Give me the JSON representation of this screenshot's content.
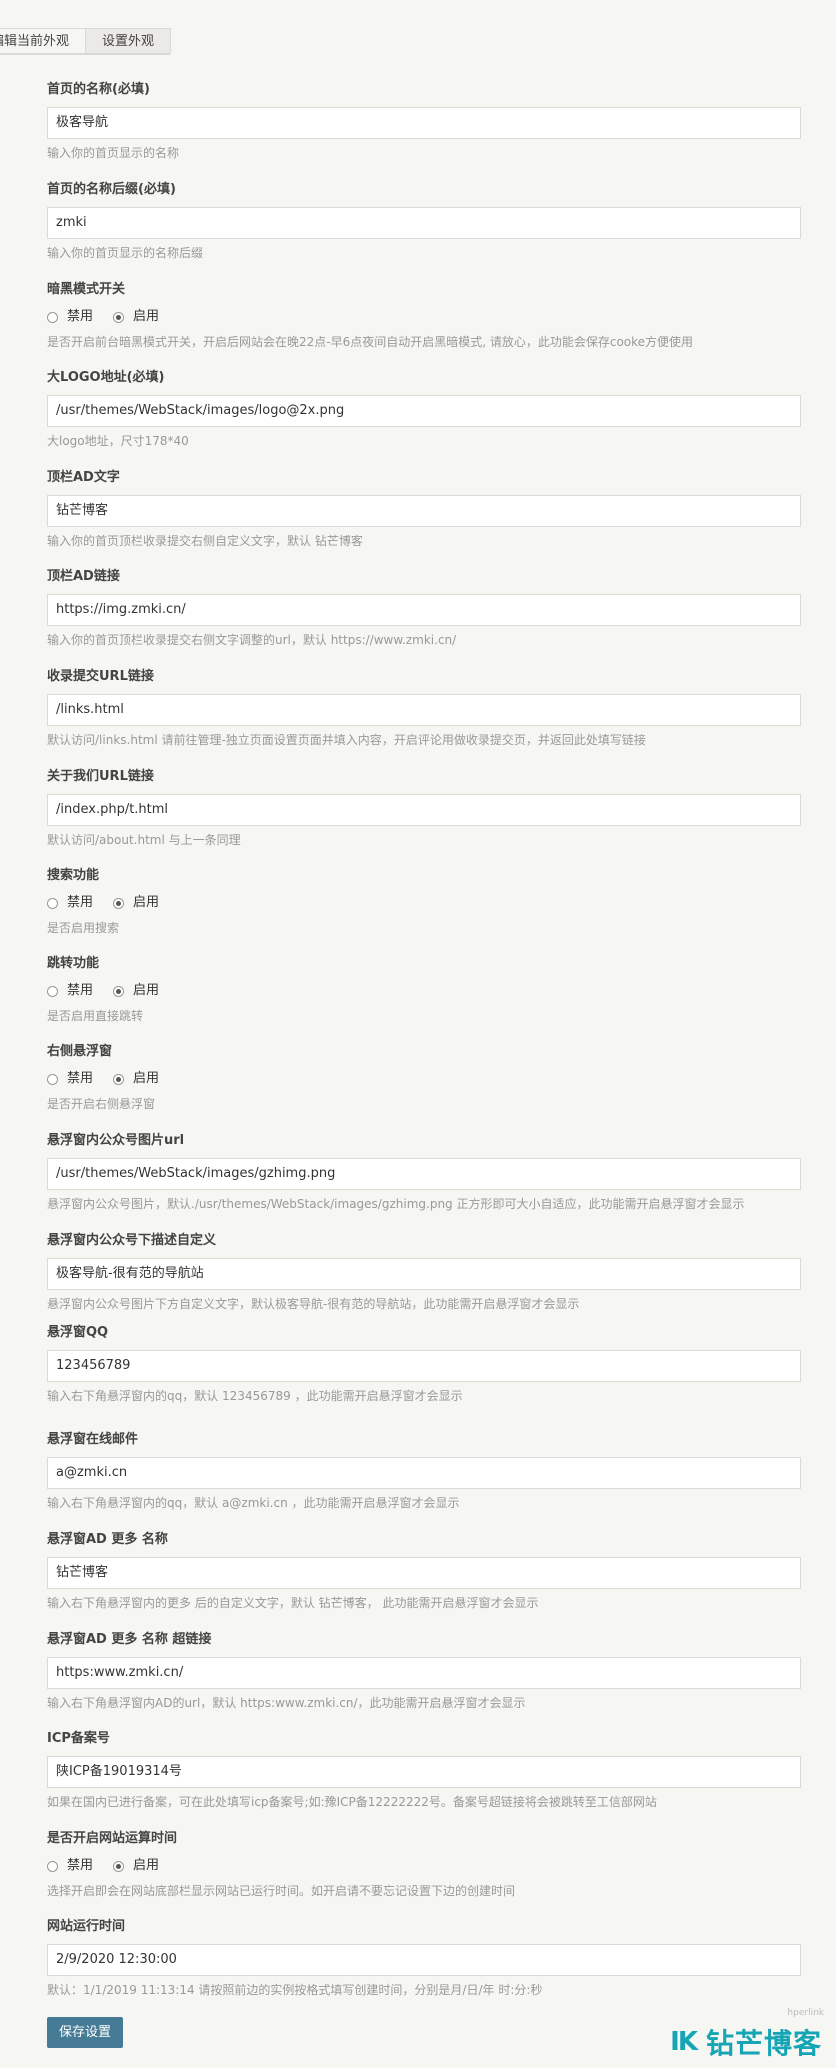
{
  "tabs": [
    {
      "label": "编辑当前外观"
    },
    {
      "label": "设置外观"
    }
  ],
  "fields": [
    {
      "label": "首页的名称(必填)",
      "value": "极客导航",
      "desc": "输入你的首页显示的名称"
    },
    {
      "label": "首页的名称后缀(必填)",
      "value": "zmki",
      "desc": "输入你的首页显示的名称后缀"
    },
    {
      "label": "暗黑模式开关",
      "radio": [
        "禁用",
        "启用"
      ],
      "desc": "是否开启前台暗黑模式开关，开启后网站会在晚22点-早6点夜间自动开启黑暗模式, 请放心，此功能会保存cooke方便使用"
    },
    {
      "label": "大LOGO地址(必填)",
      "value": "/usr/themes/WebStack/images/logo@2x.png",
      "desc": "大logo地址，尺寸178*40"
    },
    {
      "label": "顶栏AD文字",
      "value": "钻芒博客",
      "desc": "输入你的首页顶栏收录提交右侧自定义文字，默认 钻芒博客"
    },
    {
      "label": "顶栏AD链接",
      "value": "https://img.zmki.cn/",
      "desc": "输入你的首页顶栏收录提交右侧文字调整的url，默认 https://www.zmki.cn/"
    },
    {
      "label": "收录提交URL链接",
      "value": "/links.html",
      "desc": "默认访问/links.html 请前往管理-独立页面设置页面并填入内容，开启评论用做收录提交页，并返回此处填写链接"
    },
    {
      "label": "关于我们URL链接",
      "value": "/index.php/t.html",
      "desc": "默认访问/about.html 与上一条同理"
    },
    {
      "label": "搜索功能",
      "radio": [
        "禁用",
        "启用"
      ],
      "desc": "是否启用搜索"
    },
    {
      "label": "跳转功能",
      "radio": [
        "禁用",
        "启用"
      ],
      "desc": "是否启用直接跳转"
    },
    {
      "label": "右侧悬浮窗",
      "radio": [
        "禁用",
        "启用"
      ],
      "desc": "是否开启右侧悬浮窗"
    },
    {
      "label": "悬浮窗内公众号图片url",
      "value": "/usr/themes/WebStack/images/gzhimg.png",
      "desc": "悬浮窗内公众号图片，默认./usr/themes/WebStack/images/gzhimg.png 正方形即可大小自适应，此功能需开启悬浮窗才会显示"
    },
    {
      "label": "悬浮窗内公众号下描述自定义",
      "value": "极客导航-很有范的导航站",
      "desc": "悬浮窗内公众号图片下方自定义文字，默认极客导航-很有范的导航站，此功能需开启悬浮窗才会显示"
    },
    {
      "label": "悬浮窗QQ",
      "value": "123456789",
      "desc": "输入右下角悬浮窗内的qq，默认 123456789 ，此功能需开启悬浮窗才会显示"
    },
    {
      "label": "悬浮窗在线邮件",
      "value": "a@zmki.cn",
      "desc": "输入右下角悬浮窗内的qq，默认 a@zmki.cn ，此功能需开启悬浮窗才会显示"
    },
    {
      "label": "悬浮窗AD 更多 名称",
      "value": "钻芒博客",
      "desc": "输入右下角悬浮窗内的更多 后的自定义文字，默认 钻芒博客， 此功能需开启悬浮窗才会显示"
    },
    {
      "label": "悬浮窗AD 更多 名称 超链接",
      "value": "https:www.zmki.cn/",
      "desc": "输入右下角悬浮窗内AD的url，默认 https:www.zmki.cn/，此功能需开启悬浮窗才会显示"
    },
    {
      "label": "ICP备案号",
      "value": "陕ICP备19019314号",
      "desc": "如果在国内已进行备案，可在此处填写icp备案号;如:豫ICP备12222222号。备案号超链接将会被跳转至工信部网站"
    },
    {
      "label": "是否开启网站运算时间",
      "radio": [
        "禁用",
        "启用"
      ],
      "desc": "选择开启即会在网站底部栏显示网站已运行时间。如开启请不要忘记设置下边的创建时间"
    },
    {
      "label": "网站运行时间",
      "value": "2/9/2020 12:30:00",
      "desc": "默认：1/1/2019 11:13:14 请按照前边的实例按格式填写创建时间，分别是月/日/年 时:分:秒"
    }
  ],
  "save_button": "保存设置",
  "watermark": {
    "mark": "IK",
    "text": "钻芒博客",
    "small": "hperlink"
  },
  "colors": {
    "accent": "#467b96",
    "watermark": "#16a5b5"
  }
}
